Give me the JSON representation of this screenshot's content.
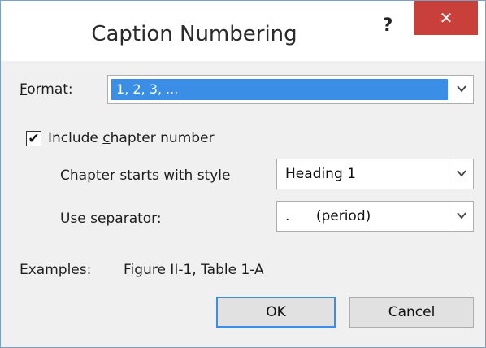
{
  "dialog": {
    "title": "Caption Numbering",
    "help": "?",
    "close": "✕"
  },
  "format": {
    "label_prefix": "",
    "label_key": "F",
    "label_rest": "ormat:",
    "value": "1, 2, 3, ..."
  },
  "chapter": {
    "checkbox_checked": true,
    "checkbox_mark": "✔",
    "checkbox_label_pre": "Include ",
    "checkbox_label_key": "c",
    "checkbox_label_post": "hapter number",
    "style_label_pre": "Cha",
    "style_label_key": "p",
    "style_label_post": "ter starts with style",
    "style_value": "Heading 1",
    "sep_label_pre": "Use s",
    "sep_label_key": "e",
    "sep_label_post": "parator:",
    "sep_value": ".      (period)"
  },
  "examples": {
    "label": "Examples:",
    "value": "Figure II-1, Table 1-A"
  },
  "buttons": {
    "ok": "OK",
    "cancel": "Cancel"
  },
  "icons": {
    "dropdown": "chevron-down-icon"
  }
}
